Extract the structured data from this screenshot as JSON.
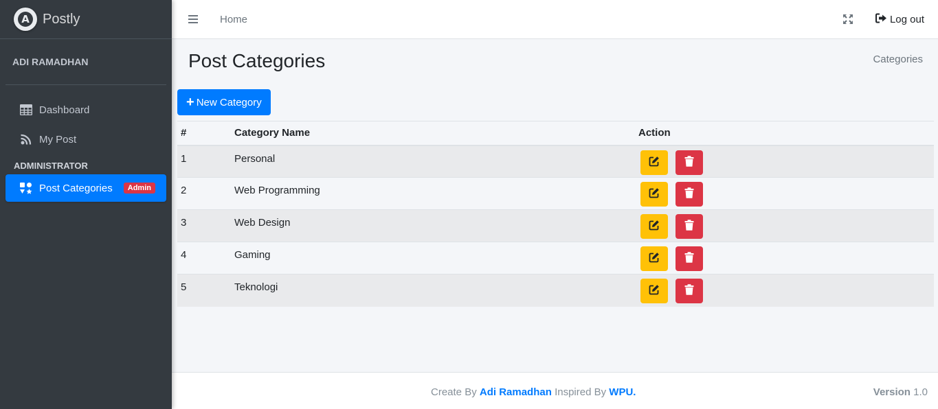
{
  "app": {
    "brand": "Postly",
    "logo_letter": "A"
  },
  "sidebar": {
    "user_name": "ADI RAMADHAN",
    "items": [
      {
        "label": "Dashboard",
        "icon": "table-icon"
      },
      {
        "label": "My Post",
        "icon": "rss-icon"
      }
    ],
    "section_header": "ADMINISTRATOR",
    "admin_items": [
      {
        "label": "Post Categories",
        "icon": "icons-icon",
        "badge": "Admin",
        "active": true
      }
    ]
  },
  "topbar": {
    "home": "Home",
    "logout": "Log out"
  },
  "page": {
    "title": "Post Categories",
    "breadcrumb": "Categories",
    "new_button": "New Category"
  },
  "table": {
    "headers": [
      "#",
      "Category Name",
      "Action"
    ],
    "rows": [
      {
        "no": "1",
        "name": "Personal"
      },
      {
        "no": "2",
        "name": "Web Programming"
      },
      {
        "no": "3",
        "name": "Web Design"
      },
      {
        "no": "4",
        "name": "Gaming"
      },
      {
        "no": "5",
        "name": "Teknologi"
      }
    ]
  },
  "footer": {
    "create_by": "Create By",
    "author": "Adi Ramadhan",
    "inspired_by": "Inspired By",
    "inspiration": "WPU.",
    "version_label": "Version",
    "version": "1.0"
  },
  "colors": {
    "primary": "#007bff",
    "warning": "#ffc107",
    "danger": "#dc3545",
    "sidebar_bg": "#343a40"
  }
}
